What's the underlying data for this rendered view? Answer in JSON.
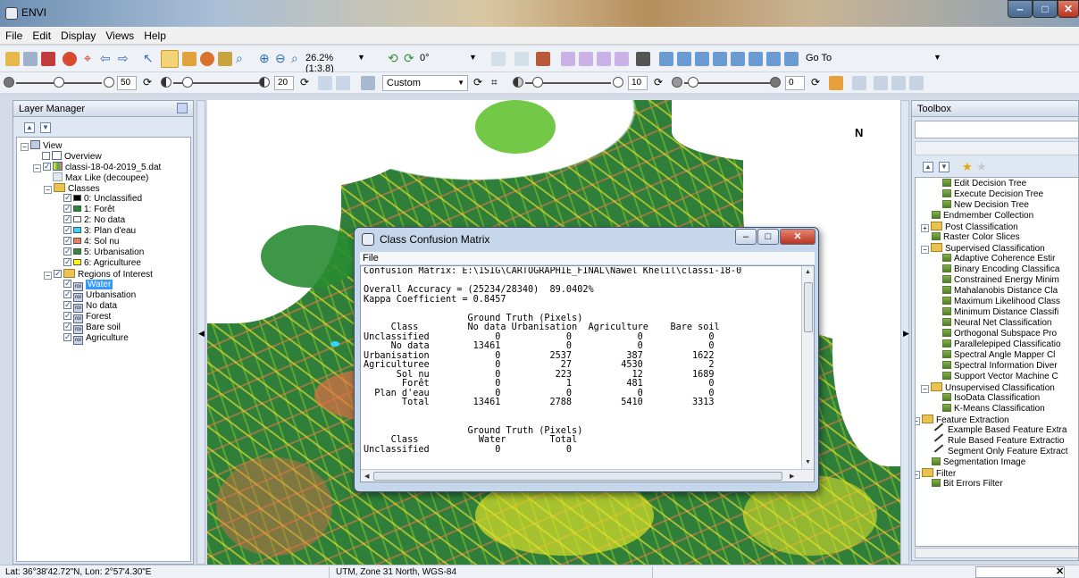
{
  "window": {
    "title": "ENVI"
  },
  "menu": [
    "File",
    "Edit",
    "Display",
    "Views",
    "Help"
  ],
  "toolbar": {
    "zoom_value": "26.2% (1:3.8)",
    "rotation_value": "0°",
    "go_to_label": "Go To",
    "stretch_value": "Custom",
    "brightness": "50",
    "contrast": "20",
    "sharpen": "10",
    "transparency": "0"
  },
  "layer_manager": {
    "title": "Layer Manager",
    "tree": {
      "root": "View",
      "overview": "Overview",
      "file": "classi-18-04-2019_5.dat",
      "method": "Max Like (decoupee)",
      "classes_folder": "Classes",
      "classes": [
        {
          "label": "0: Unclassified",
          "color": "#000000"
        },
        {
          "label": "1: Forêt",
          "color": "#1f8a2e"
        },
        {
          "label": "2: No data",
          "color": "#ffffff"
        },
        {
          "label": "3: Plan d'eau",
          "color": "#33d6ff"
        },
        {
          "label": "4: Sol nu",
          "color": "#ef7a5c"
        },
        {
          "label": "5: Urbanisation",
          "color": "#2e8b3c"
        },
        {
          "label": "6: Agriculturee",
          "color": "#ffff00"
        }
      ],
      "roi_folder": "Regions of Interest",
      "rois": [
        "Water",
        "Urbanisation",
        "No data",
        "Forest",
        "Bare soil",
        "Agriculture"
      ]
    }
  },
  "toolbox": {
    "title": "Toolbox",
    "items": [
      {
        "label": "Edit Decision Tree",
        "type": "tool"
      },
      {
        "label": "Execute Decision Tree",
        "type": "tool"
      },
      {
        "label": "New Decision Tree",
        "type": "tool"
      },
      {
        "label": "Endmember Collection",
        "type": "tool"
      },
      {
        "label": "Post Classification",
        "type": "folder"
      },
      {
        "label": "Raster Color Slices",
        "type": "tool"
      },
      {
        "label": "Supervised Classification",
        "type": "folder"
      },
      {
        "label": "Adaptive Coherence Estir",
        "type": "tool"
      },
      {
        "label": "Binary Encoding Classifica",
        "type": "tool"
      },
      {
        "label": "Constrained Energy Minim",
        "type": "tool"
      },
      {
        "label": "Mahalanobis Distance Cla",
        "type": "tool"
      },
      {
        "label": "Maximum Likelihood Class",
        "type": "tool"
      },
      {
        "label": "Minimum Distance Classifi",
        "type": "tool"
      },
      {
        "label": "Neural Net Classification",
        "type": "tool"
      },
      {
        "label": "Orthogonal Subspace Pro",
        "type": "tool"
      },
      {
        "label": "Parallelepiped Classificatio",
        "type": "tool"
      },
      {
        "label": "Spectral Angle Mapper Cl",
        "type": "tool"
      },
      {
        "label": "Spectral Information Diver",
        "type": "tool"
      },
      {
        "label": "Support Vector Machine C",
        "type": "tool"
      },
      {
        "label": "Unsupervised Classification",
        "type": "folder"
      },
      {
        "label": "IsoData Classification",
        "type": "tool"
      },
      {
        "label": "K-Means Classification",
        "type": "tool"
      },
      {
        "label": "Feature Extraction",
        "type": "folder"
      },
      {
        "label": "Example Based Feature Extra",
        "type": "wand"
      },
      {
        "label": "Rule Based Feature Extractio",
        "type": "wand"
      },
      {
        "label": "Segment Only Feature Extract",
        "type": "wand"
      },
      {
        "label": "Segmentation Image",
        "type": "tool"
      },
      {
        "label": "Filter",
        "type": "folder"
      },
      {
        "label": "Bit Errors Filter",
        "type": "tool"
      }
    ]
  },
  "map": {
    "north_label": "N"
  },
  "dialog": {
    "title": "Class Confusion Matrix",
    "menu_file": "File",
    "text_lines": [
      "Confusion Matrix: E:\\1SIG\\CARTOGRAPHIE_FINAL\\Nawel Khelil\\classi-18-0",
      "",
      "Overall Accuracy = (25234/28340)  89.0402%",
      "Kappa Coefficient = 0.8457",
      "",
      "                   Ground Truth (Pixels)",
      "     Class         No data Urbanisation  Agriculture    Bare soil",
      "Unclassified            0            0            0            0",
      "     No data        13461            0            0            0",
      "Urbanisation            0         2537          387         1622",
      "Agriculturee            0           27         4530            2",
      "      Sol nu            0          223           12         1689",
      "       Forêt            0            1          481            0",
      "  Plan d'eau            0            0            0            0",
      "       Total        13461         2788         5410         3313",
      "",
      "",
      "                   Ground Truth (Pixels)",
      "     Class           Water        Total",
      "Unclassified            0            0"
    ]
  },
  "status": {
    "coords": "Lat: 36°38'42.72\"N, Lon: 2°57'4.30\"E",
    "projection": "UTM, Zone 31 North, WGS-84"
  }
}
